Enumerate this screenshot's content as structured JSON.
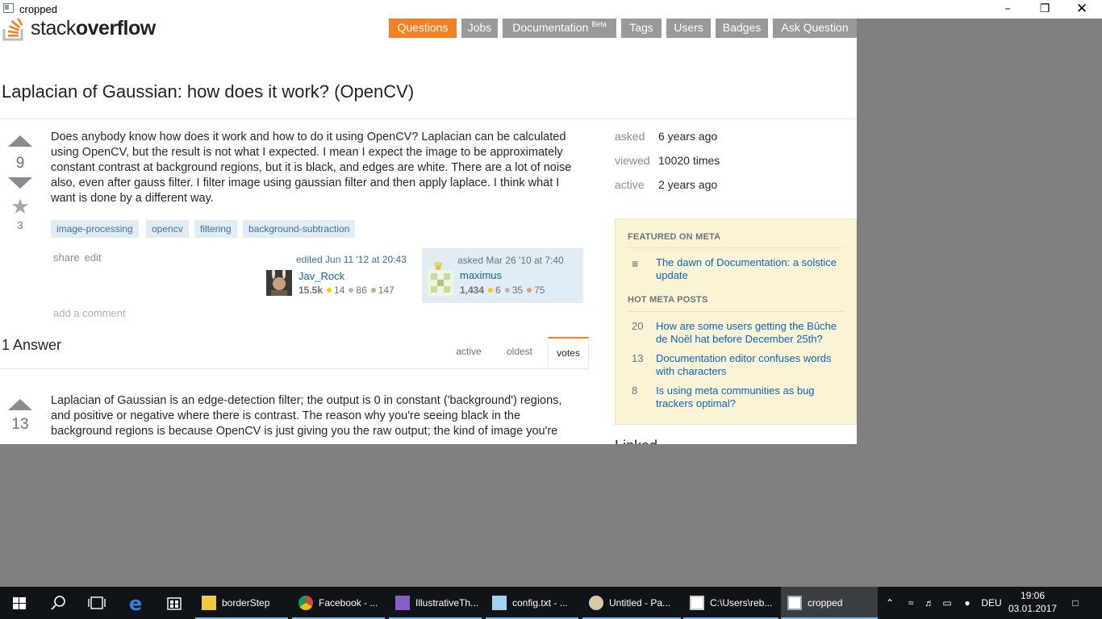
{
  "window": {
    "title": "cropped"
  },
  "site": {
    "logo_left": "stack",
    "logo_right": "overflow"
  },
  "nav": [
    {
      "label": "Questions",
      "active": true
    },
    {
      "label": "Jobs"
    },
    {
      "label": "Documentation",
      "sup": "Beta"
    },
    {
      "label": "Tags"
    },
    {
      "label": "Users"
    },
    {
      "label": "Badges"
    },
    {
      "label": "Ask Question"
    }
  ],
  "question": {
    "title": "Laplacian of Gaussian: how does it work? (OpenCV)",
    "votes": "9",
    "favorites": "3",
    "body": "Does anybody know how does it work and how to do it using OpenCV? Laplacian can be calculated using OpenCV, but the result is not what I expected. I mean I expect the image to be approximately constant contrast at background regions, but it is black, and edges are white. There are a lot of noise also, even after gauss filter. I filter image using gaussian filter and then apply laplace. I think what I want is done by a different way.",
    "tags": [
      "image-processing",
      "opencv",
      "filtering",
      "background-subtraction"
    ],
    "menu": {
      "share": "share",
      "edit": "edit"
    },
    "editor": {
      "action": "edited Jun 11 '12 at 20:43",
      "name": "Jav_Rock",
      "rep": "15.5k",
      "gold": "14",
      "silver": "86",
      "bronze": "147"
    },
    "owner": {
      "action": "asked Mar 26 '10 at 7:40",
      "name": "maximus",
      "rep": "1,434",
      "gold": "6",
      "silver": "35",
      "bronze": "75"
    },
    "add_comment": "add a comment"
  },
  "answers": {
    "header": "1 Answer",
    "tabs": [
      "active",
      "oldest",
      "votes"
    ],
    "active_tab": "votes",
    "first": {
      "votes": "13",
      "body": "Laplacian of Gaussian is an edge-detection filter; the output is 0 in constant ('background') regions, and positive or negative where there is contrast. The reason why you're seeing black in the background regions is because OpenCV is just giving you the raw output; the kind of image you're"
    }
  },
  "sidebar": {
    "stats": [
      {
        "label": "asked",
        "value": "6 years ago"
      },
      {
        "label": "viewed",
        "value": "10020 times"
      },
      {
        "label": "active",
        "value": "2 years ago"
      }
    ],
    "featured_head": "FEATURED ON META",
    "featured": [
      {
        "text": "The dawn of Documentation: a solstice update"
      }
    ],
    "hot_head": "HOT META POSTS",
    "hot": [
      {
        "num": "20",
        "text": "How are some users getting the Bûche de Noël hat before December 25th?"
      },
      {
        "num": "13",
        "text": "Documentation editor confuses words with characters"
      },
      {
        "num": "8",
        "text": "Is using meta communities as bug trackers optimal?"
      }
    ],
    "linked_head": "Linked"
  },
  "taskbar": {
    "apps": [
      {
        "label": "borderStep",
        "icon": "folder-icon"
      },
      {
        "label": "Facebook - ...",
        "icon": "chrome-icon"
      },
      {
        "label": "IllustrativeTh...",
        "icon": "visual-studio-icon"
      },
      {
        "label": "config.txt - ...",
        "icon": "notepad-icon"
      },
      {
        "label": "Untitled - Pa...",
        "icon": "paint-icon"
      },
      {
        "label": "C:\\Users\\reb...",
        "icon": "console-icon"
      },
      {
        "label": "cropped",
        "icon": "image-viewer-icon"
      }
    ],
    "language": "DEU",
    "time": "19:06",
    "date": "03.01.2017"
  },
  "colors": {
    "accent": "#f48024",
    "link": "#0c65b5",
    "tag_bg": "#e1ecf4",
    "meta_bg": "#fbf3d5"
  }
}
